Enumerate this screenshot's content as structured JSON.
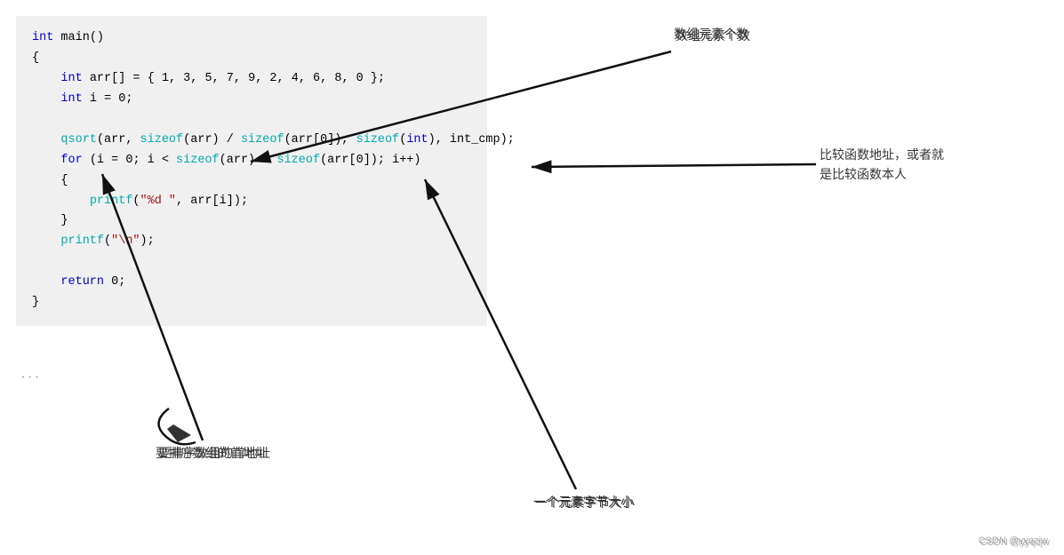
{
  "code": {
    "lines": [
      {
        "id": "l1",
        "content": "int main()"
      },
      {
        "id": "l2",
        "content": "{"
      },
      {
        "id": "l3",
        "content": "    int arr[] = { 1, 3, 5, 7, 9, 2, 4, 6, 8, 0 };"
      },
      {
        "id": "l4",
        "content": "    int i = 0;"
      },
      {
        "id": "l5",
        "content": ""
      },
      {
        "id": "l6",
        "content": "    qsort(arr, sizeof(arr) / sizeof(arr[0]), sizeof(int), int_cmp);"
      },
      {
        "id": "l7",
        "content": "    for (i = 0; i < sizeof(arr) / sizeof(arr[0]); i++)"
      },
      {
        "id": "l8",
        "content": "    {"
      },
      {
        "id": "l9",
        "content": "        printf(\"%d \", arr[i]);"
      },
      {
        "id": "l10",
        "content": "    }"
      },
      {
        "id": "l11",
        "content": "    printf(\"\\n\");"
      },
      {
        "id": "l12",
        "content": ""
      },
      {
        "id": "l13",
        "content": "    return 0;"
      },
      {
        "id": "l14",
        "content": "}"
      }
    ],
    "dots": "···"
  },
  "annotations": {
    "array_elements": "数组元素个数",
    "compare_func": "比较函数地址，或者就\n是比较函数本人",
    "first_address": "要排序数组的首地址",
    "element_size": "一个元素字节大小"
  },
  "watermark": "CSDN @yyqzjw"
}
